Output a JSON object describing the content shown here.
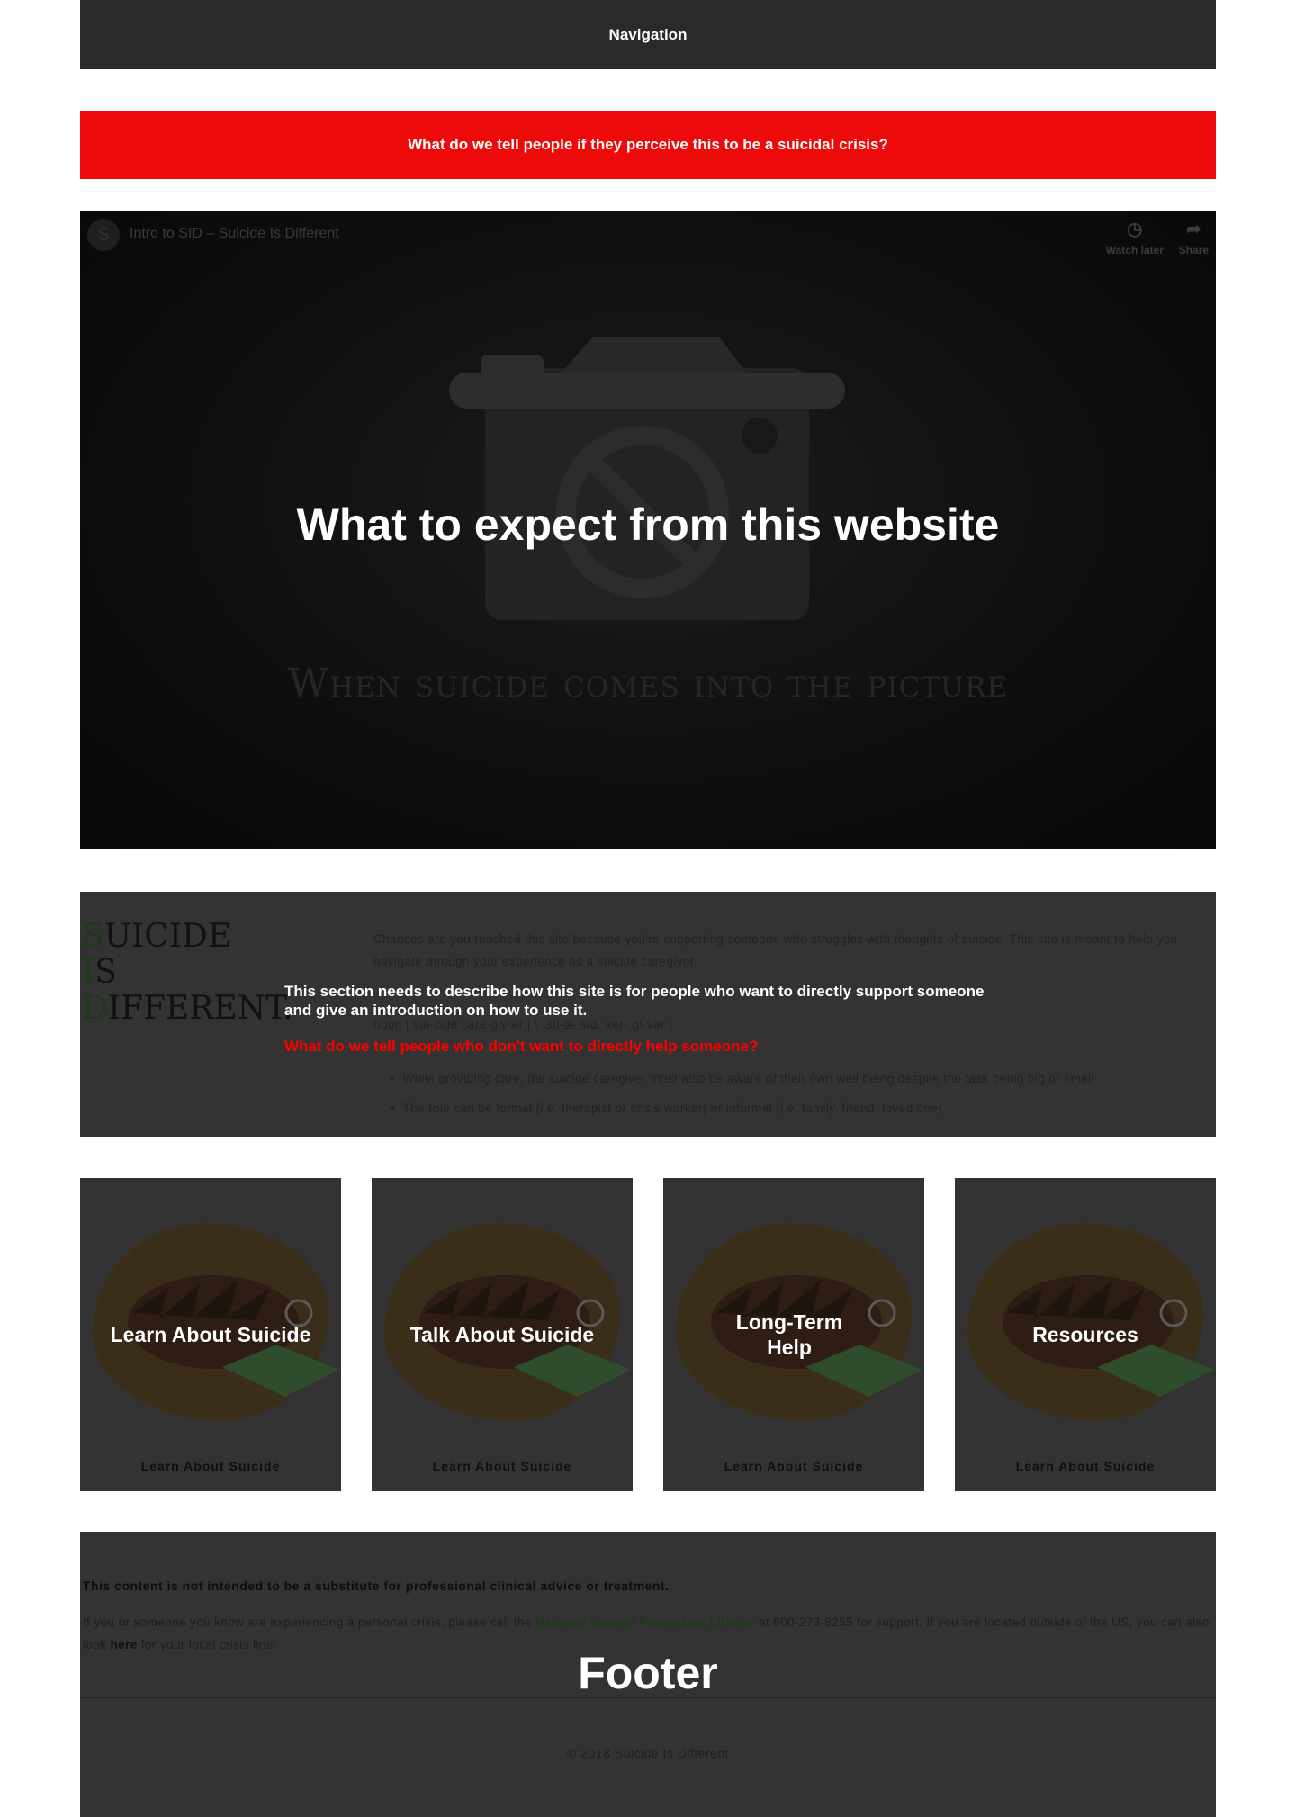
{
  "nav": {
    "label": "Navigation"
  },
  "crisis_banner": {
    "text": "What do we tell people if they perceive this to be a suicidal crisis?"
  },
  "video": {
    "channel_initial": "S",
    "title": "Intro to SID – Suicide Is Different",
    "watch_later": "Watch later",
    "share": "Share",
    "overlay_title": "What to expect from this website",
    "tagline": "When suicide comes into the picture"
  },
  "intro": {
    "logo_letters": [
      "S",
      "I",
      "D"
    ],
    "logo_rest": [
      "UICIDE",
      "S",
      "IFFERENT."
    ],
    "paragraph": "Chances are you reached this site because you're supporting someone who struggles with thoughts of suicide. This site is meant to help you navigate through your experience as a suicide caregiver.",
    "definition_line": "noun | sui·cide care·giv·er | \\ ˈsü-ə-ˌsīd ˈker-ˌgi-vər \\",
    "bullets": [
      "While providing care, the suicide caregiver must also be aware of their own well being despite the task being big or small",
      "The role can be formal (i.e. therapist or crisis worker) or informal (i.e. family, friend, loved one)"
    ],
    "overlay_note": "This section needs to describe how this site is for people who want to directly support someone and give an introduction on how to use it.",
    "overlay_question": "What do we tell people who don't want to directly help someone?"
  },
  "cards": [
    {
      "title": "Learn About Suicide",
      "link": "Learn About Suicide"
    },
    {
      "title": "Talk About Suicide",
      "link": "Learn About Suicide"
    },
    {
      "title": "Long-Term Help",
      "link": "Learn About Suicide"
    },
    {
      "title": "Resources",
      "link": "Learn About Suicide"
    }
  ],
  "footer": {
    "disclaimer": "This content is not intended to be a substitute for professional clinical advice or treatment.",
    "crisis_pre": "If you or someone you know are experiencing a personal crisis, please call the ",
    "lifeline": "National Suicide Prevention Lifeline",
    "crisis_mid": " at 800-273-8255 for support. If you are located outside of the US, you can also look ",
    "here": "here",
    "crisis_post": " for your local crisis line.",
    "overlay_label": "Footer",
    "copyright": "© 2018 Suicide Is Different"
  }
}
